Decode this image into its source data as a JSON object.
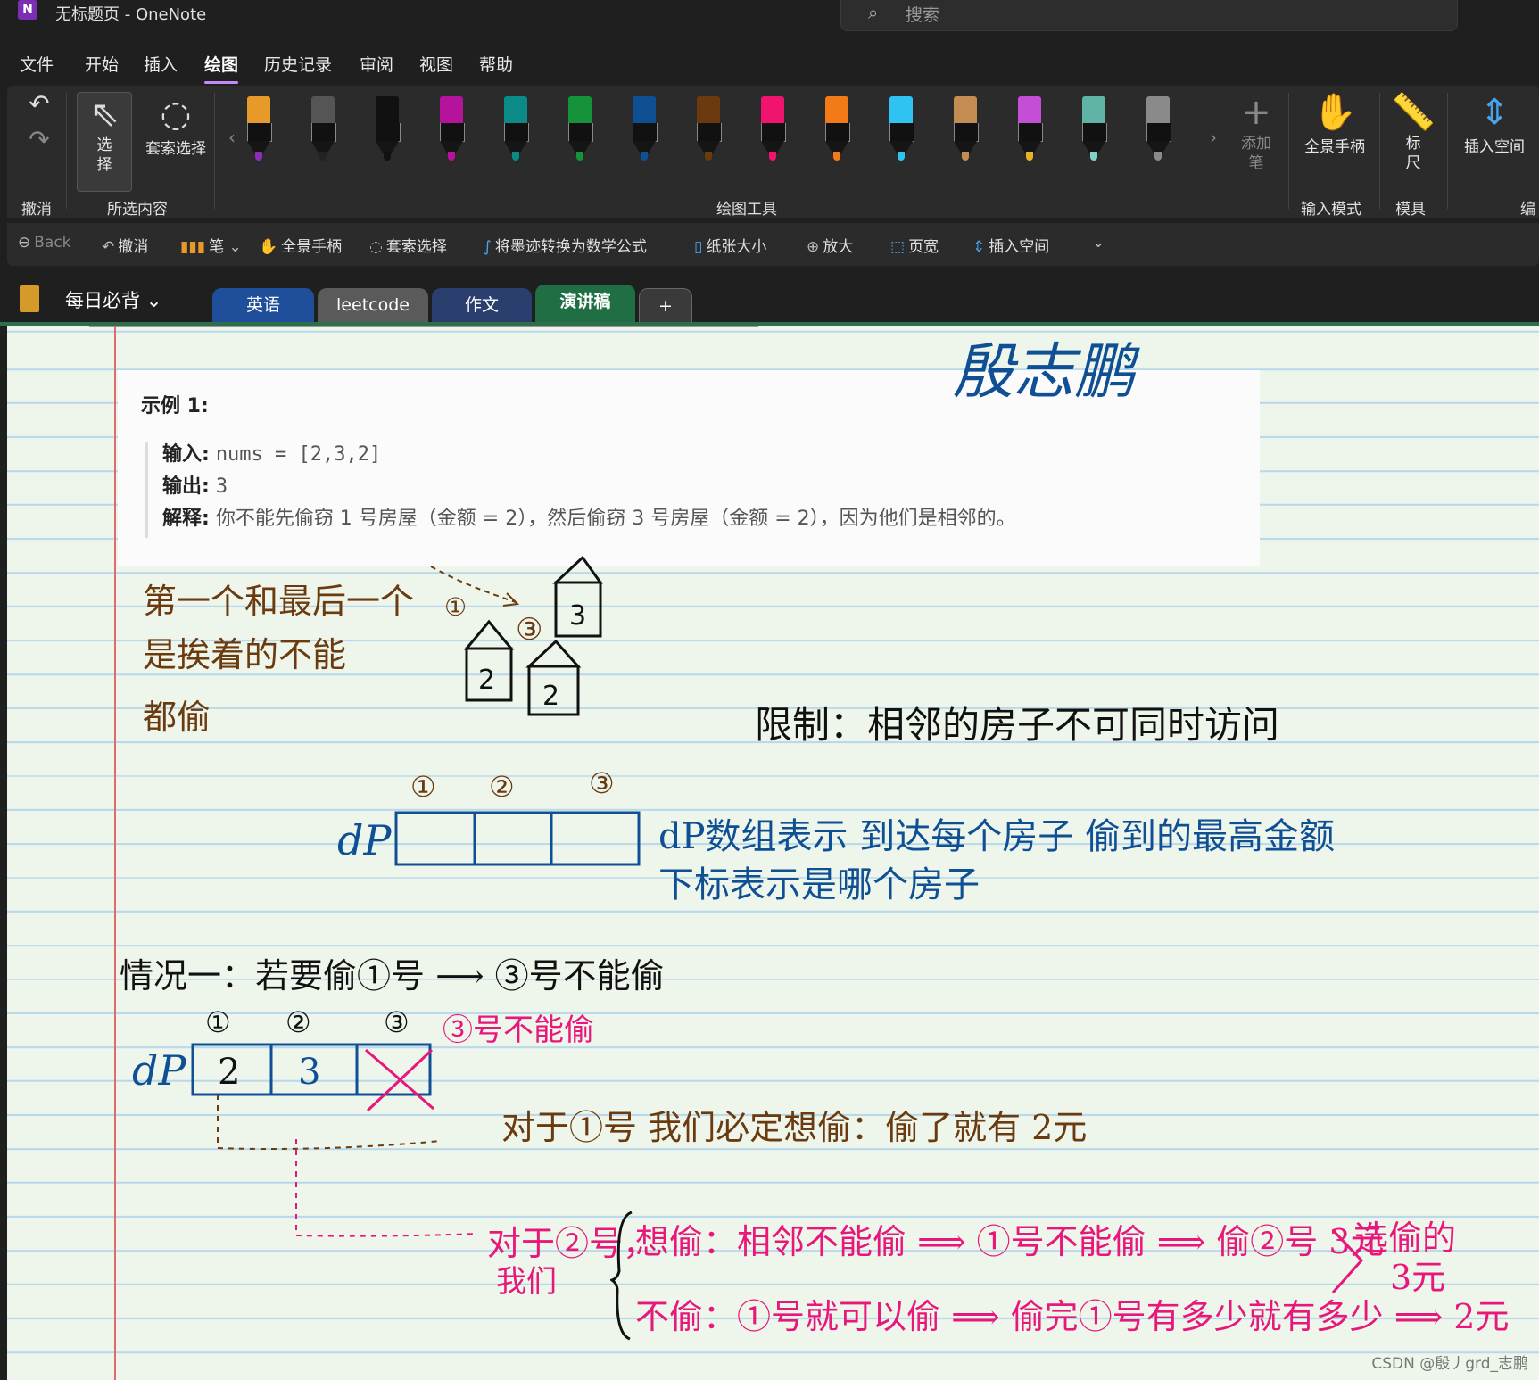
{
  "window": {
    "app_icon": "N",
    "title": "无标题页  -  OneNote"
  },
  "search": {
    "placeholder": "搜索",
    "icon": "search-icon"
  },
  "menu": {
    "tabs": [
      "文件",
      "开始",
      "插入",
      "绘图",
      "历史记录",
      "审阅",
      "视图",
      "帮助"
    ],
    "active": "绘图"
  },
  "ribbon": {
    "undo_group_label": "撤消",
    "selection_group_label": "所选内容",
    "select_label": "选\n择",
    "lasso_label": "套索选择",
    "drawing_tools_label": "绘图工具",
    "add_pen_label": "添加\n笔",
    "input_mode_label": "输入模式",
    "pan_label": "全景手柄",
    "stencil_label": "模具",
    "ruler_label": "标\n尺",
    "insert_space_label": "插入空间",
    "edit_label": "编",
    "pens": [
      {
        "body": "#e79a2a",
        "nib": "#8a2fb5"
      },
      {
        "body": "#555555",
        "nib": "#222222"
      },
      {
        "body": "#111111",
        "nib": "#111111"
      },
      {
        "body": "#b5139b",
        "nib": "#b5139b"
      },
      {
        "body": "#0b8a87",
        "nib": "#0b8a87"
      },
      {
        "body": "#16923b",
        "nib": "#16923b"
      },
      {
        "body": "#0f4f94",
        "nib": "#0f4f94"
      },
      {
        "body": "#6b3a0e",
        "nib": "#6b3a0e"
      },
      {
        "body": "#f0146e",
        "nib": "#f0146e"
      },
      {
        "body": "#f27a17",
        "nib": "#f27a17"
      },
      {
        "body": "#2fc3f2",
        "nib": "#2fc3f2"
      },
      {
        "body": "#c58c52",
        "nib": "#c58c52"
      },
      {
        "body": "#c44fd6",
        "nib": "#e6b422"
      },
      {
        "body": "#5fb4a6",
        "nib": "#7fd3c6"
      },
      {
        "body": "#8a8a8a",
        "nib": "#8a8a8a"
      }
    ]
  },
  "quick_access": {
    "items": [
      "Back",
      "撤消",
      "笔",
      "全景手柄",
      "套索选择",
      "将墨迹转换为数学公式",
      "纸张大小",
      "放大",
      "页宽",
      "插入空间"
    ]
  },
  "notebook": {
    "name": "每日必背",
    "sections": [
      {
        "label": "英语",
        "color": "#1f4f9a"
      },
      {
        "label": "leetcode",
        "color": "#5a5a5a"
      },
      {
        "label": "作文",
        "color": "#2a3f6e"
      },
      {
        "label": "演讲稿",
        "color": "#1f6e44"
      },
      {
        "label": "+",
        "color": "#3a3a3a"
      }
    ]
  },
  "example": {
    "title": "示例 1:",
    "input_label": "输入:",
    "input_value": "nums = [2,3,2]",
    "output_label": "输出:",
    "output_value": "3",
    "explain_label": "解释:",
    "explain_value": "你不能先偷窃 1 号房屋（金额 = 2），然后偷窃 3 号房屋（金额 = 2），因为他们是相邻的。"
  },
  "handwriting": {
    "signature": "殷志鹏",
    "note1_line1": "第一个和最后一个",
    "note1_line2": "是挨着的不能",
    "note1_line3": "都偷",
    "limit": "限制：相邻的房子不可同时访问",
    "house_labels": [
      "3",
      "2",
      "2"
    ],
    "house_circles": [
      "①",
      "③"
    ],
    "dp_label": "dP",
    "dp_indices": [
      "①",
      "②",
      "③"
    ],
    "dp_desc1": "dP数组表示 到达每个房子 偷到的最高金额",
    "dp_desc2": "下标表示是哪个房子",
    "case1": "情况一：若要偷①号 ⟶ ③号不能偷",
    "dp2_label": "dP",
    "dp2_indices": [
      "①",
      "②",
      "③"
    ],
    "dp2_values": [
      "2",
      "3"
    ],
    "no_steal3": "③号不能偷",
    "for1": "对于①号 我们必定想偷：偷了就有 2元",
    "for2_a": "对于②号，",
    "for2_b": "我们",
    "branch1": "想偷：相邻不能偷 ⟹ ①号不能偷 ⟹ 偷②号   3元",
    "branch2": "不偷：①号就可以偷 ⟹ 偷完①号有多少就有多少 ⟹ 2元",
    "choose": "选偷的",
    "choose_val": "3元"
  },
  "watermark": "CSDN @殷丿grd_志鹏"
}
